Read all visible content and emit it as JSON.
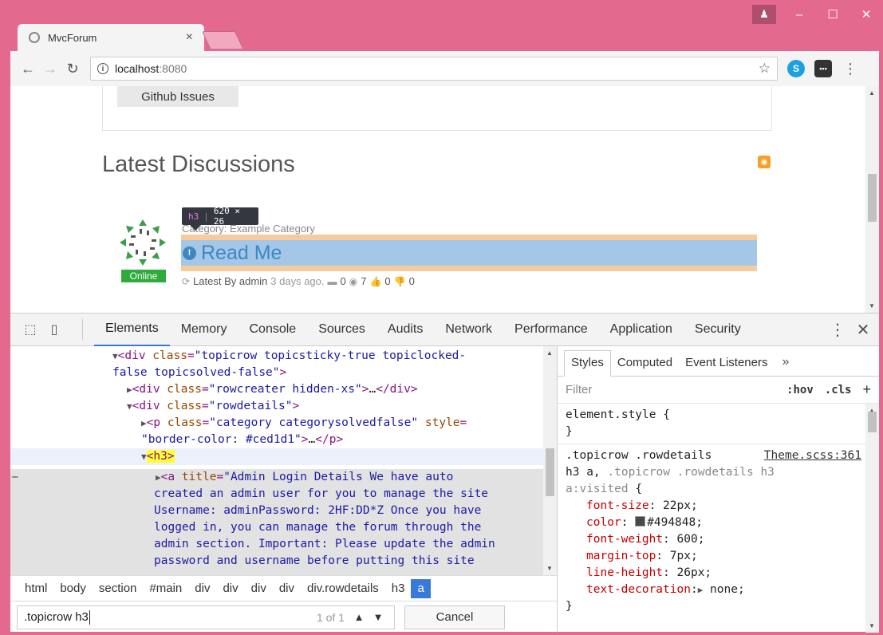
{
  "browser": {
    "tab_title": "MvcForum",
    "tab_close": "×",
    "url_host": "localhost",
    "url_port": ":8080",
    "window_controls": {
      "minimize": "–",
      "maximize": "☐",
      "close": "✕"
    }
  },
  "page": {
    "github_button": "Github Issues",
    "section_title": "Latest Discussions",
    "topic": {
      "category_label": "Category: Example Category",
      "title": "Read Me",
      "online_badge": "Online",
      "meta_latest": "Latest By admin",
      "meta_time": "3 days ago.",
      "counts": {
        "comments": "0",
        "views": "7",
        "up": "0",
        "down": "0"
      }
    },
    "inspect_tooltip": {
      "tag": "h3",
      "size": "620 × 26"
    }
  },
  "devtools": {
    "tabs": [
      "Elements",
      "Memory",
      "Console",
      "Sources",
      "Audits",
      "Network",
      "Performance",
      "Application",
      "Security"
    ],
    "active_tab": "Elements",
    "dom_lines": {
      "l1_attr": "class",
      "l1_val": "\"topicrow topicsticky-true topiclocked-",
      "l2_val": "false topicsolved-false\"",
      "l3_val": "\"rowcreater hidden-xs\"",
      "l3_ellipsis": "…",
      "l4_val": "\"rowdetails\"",
      "l5_attr2": "style",
      "l5_val": "\"category categorysolvedfalse\"",
      "l6_val": "\"border-color: #ced1d1\"",
      "l6_ellipsis": "…",
      "l7_tag": "<h3>",
      "l8_attr": "title",
      "l8_val": "\"Admin Login Details We have auto",
      "l9": "created an admin user for you to manage the site",
      "l10": "Username: adminPassword: 2HF:DD*Z Once you have",
      "l11": "logged in, you can manage the forum through the",
      "l12": "admin section. Important: Please update the admin",
      "l13": "password and username before putting this site"
    },
    "breadcrumbs": [
      "html",
      "body",
      "section",
      "#main",
      "div",
      "div",
      "div",
      "div",
      "div.rowdetails",
      "h3",
      "a"
    ],
    "search": {
      "query": ".topicrow h3",
      "count": "1 of 1",
      "cancel": "Cancel"
    },
    "styles": {
      "tabs": [
        "Styles",
        "Computed",
        "Event Listeners"
      ],
      "more": "»",
      "filter_placeholder": "Filter",
      "hov": ":hov",
      "cls": ".cls",
      "plus": "+",
      "element_style": "element.style {",
      "close_brace": "}",
      "rule_selector_1": ".topicrow .rowdetails",
      "rule_source": "Theme.scss:361",
      "rule_selector_2a": "h3 a,",
      "rule_selector_2b": ".topicrow .rowdetails h3",
      "rule_selector_3": "a:visited",
      "open_brace": "{",
      "props": [
        {
          "name": "font-size",
          "value": "22px;"
        },
        {
          "name": "color",
          "value": "#494848;"
        },
        {
          "name": "font-weight",
          "value": "600;"
        },
        {
          "name": "margin-top",
          "value": "7px;"
        },
        {
          "name": "line-height",
          "value": "26px;"
        },
        {
          "name": "text-decoration",
          "value": "none;"
        }
      ]
    }
  },
  "colors": {
    "frame": "#e36a8e",
    "accent": "#3879d9",
    "h3_content": "#a4c6e7",
    "h3_margin": "#f8cb9c",
    "online": "#2eab3d",
    "swatch": "#494848"
  }
}
